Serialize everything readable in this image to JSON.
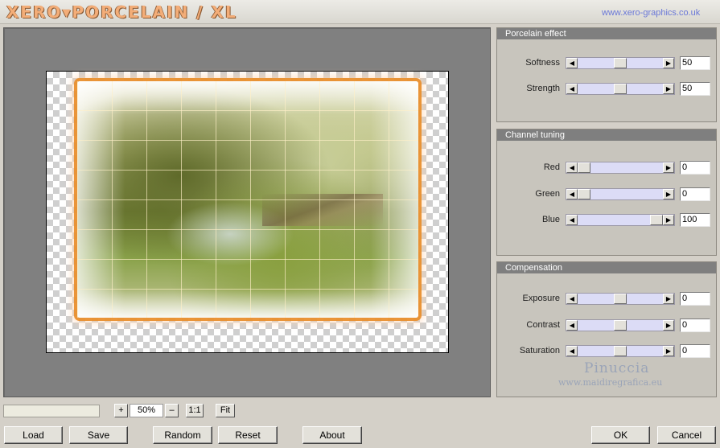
{
  "header": {
    "title": "XERO▾PORCELAIN / XL",
    "site_link": "www.xero-graphics.co.uk"
  },
  "panels": {
    "porcelain": {
      "title": "Porcelain effect",
      "rows": [
        {
          "label": "Softness",
          "value": "50",
          "fraction": 0.5
        },
        {
          "label": "Strength",
          "value": "50",
          "fraction": 0.5
        }
      ]
    },
    "channel": {
      "title": "Channel tuning",
      "rows": [
        {
          "label": "Red",
          "value": "0",
          "fraction": 0.0
        },
        {
          "label": "Green",
          "value": "0",
          "fraction": 0.0
        },
        {
          "label": "Blue",
          "value": "100",
          "fraction": 1.0
        }
      ]
    },
    "compensation": {
      "title": "Compensation",
      "rows": [
        {
          "label": "Exposure",
          "value": "0",
          "fraction": 0.5
        },
        {
          "label": "Contrast",
          "value": "0",
          "fraction": 0.5
        },
        {
          "label": "Saturation",
          "value": "0",
          "fraction": 0.5
        }
      ]
    }
  },
  "watermark": {
    "name": "Pinuccia",
    "site": "www.maidiregrafica.eu"
  },
  "zoom": {
    "plus": "+",
    "value": "50%",
    "minus": "–",
    "one_to_one": "1:1",
    "fit": "Fit"
  },
  "buttons": {
    "load": "Load",
    "save": "Save",
    "random": "Random",
    "reset": "Reset",
    "about": "About",
    "ok": "OK",
    "cancel": "Cancel"
  },
  "icons": {
    "slider_left": "triangle-left-icon",
    "slider_right": "triangle-right-icon"
  },
  "colors": {
    "panel_title_bg": "#7f7f7f",
    "slider_track": "#dcdcf6",
    "title_orange": "#f3ad78",
    "link_blue": "#6a78d8"
  }
}
